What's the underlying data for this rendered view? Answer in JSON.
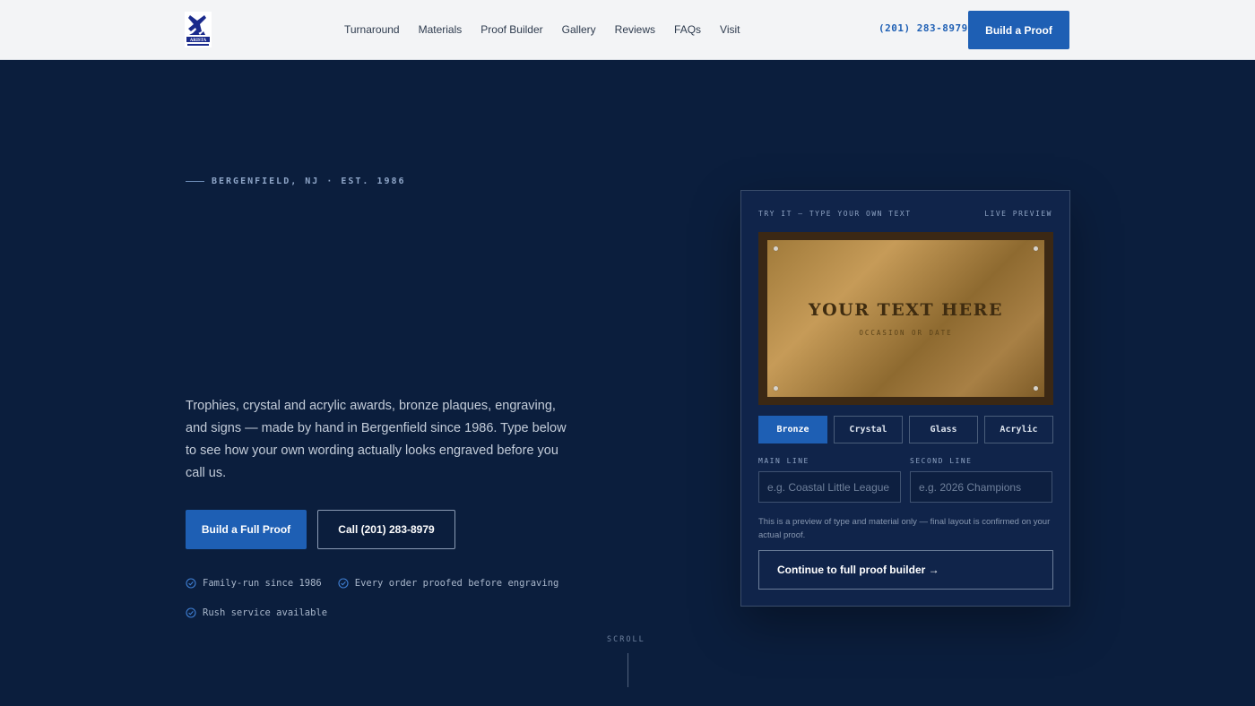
{
  "header": {
    "logo_alt": "ARISTA",
    "nav": [
      "Turnaround",
      "Materials",
      "Proof Builder",
      "Gallery",
      "Reviews",
      "FAQs",
      "Visit"
    ],
    "phone": "(201) 283-8979",
    "cta": "Build a Proof"
  },
  "hero": {
    "eyebrow": "BERGENFIELD, NJ · EST. 1986",
    "description": "Trophies, crystal and acrylic awards, bronze plaques, engraving, and signs — made by hand in Bergenfield since 1986. Type below to see how your own wording actually looks engraved before you call us.",
    "primary_button": "Build a Full Proof",
    "secondary_button": "Call (201) 283-8979",
    "features": [
      "Family-run since 1986",
      "Every order proofed before engraving",
      "Rush service available"
    ],
    "scroll": "SCROLL"
  },
  "preview": {
    "title": "TRY IT — TYPE YOUR OWN TEXT",
    "live": "LIVE PREVIEW",
    "plaque_main": "YOUR TEXT HERE",
    "plaque_sub": "OCCASION OR DATE",
    "materials": [
      "Bronze",
      "Crystal",
      "Glass",
      "Acrylic"
    ],
    "selected_material": "Bronze",
    "main_label": "MAIN LINE",
    "main_placeholder": "e.g. Coastal Little League",
    "second_label": "SECOND LINE",
    "second_placeholder": "e.g. 2026 Champions",
    "note": "This is a preview of type and material only — final layout is confirmed on your actual proof.",
    "continue": "Continue to full proof builder →"
  },
  "colors": {
    "background": "#0b1e3d",
    "accent": "#1e5fb4",
    "header_bg": "#f3f4f6",
    "bronze": "#b08a4a"
  }
}
